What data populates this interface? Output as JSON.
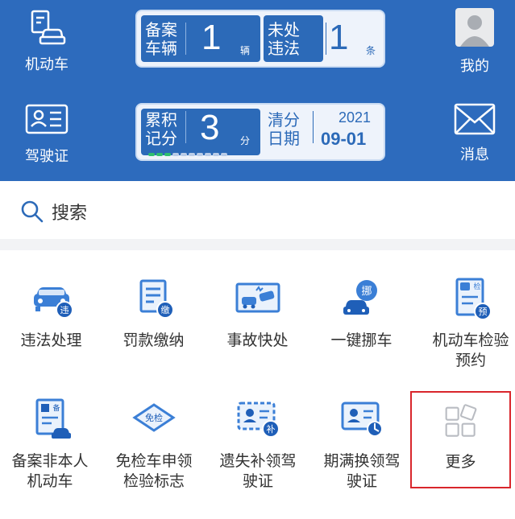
{
  "header": {
    "vehicle": {
      "label": "机动车",
      "icon": "car-document-icon"
    },
    "license": {
      "label": "驾驶证",
      "icon": "id-card-icon"
    },
    "mine": {
      "label": "我的",
      "icon": "avatar-icon"
    },
    "messages": {
      "label": "消息",
      "icon": "envelope-icon"
    },
    "card1": {
      "label_a": "备案车辆",
      "value_a": "1",
      "unit_a": "辆",
      "label_b": "未处违法",
      "value_b": "1",
      "unit_b": "条"
    },
    "card2": {
      "label_a": "累积记分",
      "value_a": "3",
      "unit_a": "分",
      "label_b": "清分日期",
      "year": "2021",
      "date": "09-01"
    }
  },
  "search": {
    "label": "搜索",
    "icon": "search-icon"
  },
  "services": [
    {
      "label": "违法处理",
      "icon": "violation-car-icon"
    },
    {
      "label": "罚款缴纳",
      "icon": "fine-payment-icon"
    },
    {
      "label": "事故快处",
      "icon": "accident-icon"
    },
    {
      "label": "一键挪车",
      "icon": "move-car-icon"
    },
    {
      "label": "机动车检验预约",
      "icon": "inspection-booking-icon"
    },
    {
      "label": "备案非本人机动车",
      "icon": "register-vehicle-icon"
    },
    {
      "label": "免检车申领检验标志",
      "icon": "exempt-inspection-icon"
    },
    {
      "label": "遗失补领驾驶证",
      "icon": "lost-license-icon"
    },
    {
      "label": "期满换领驾驶证",
      "icon": "renew-license-icon"
    },
    {
      "label": "更多",
      "icon": "more-grid-icon"
    }
  ],
  "colors": {
    "header_bg": "#2d6bbd",
    "accent": "#2c6ab8",
    "highlight": "#d9262c"
  }
}
